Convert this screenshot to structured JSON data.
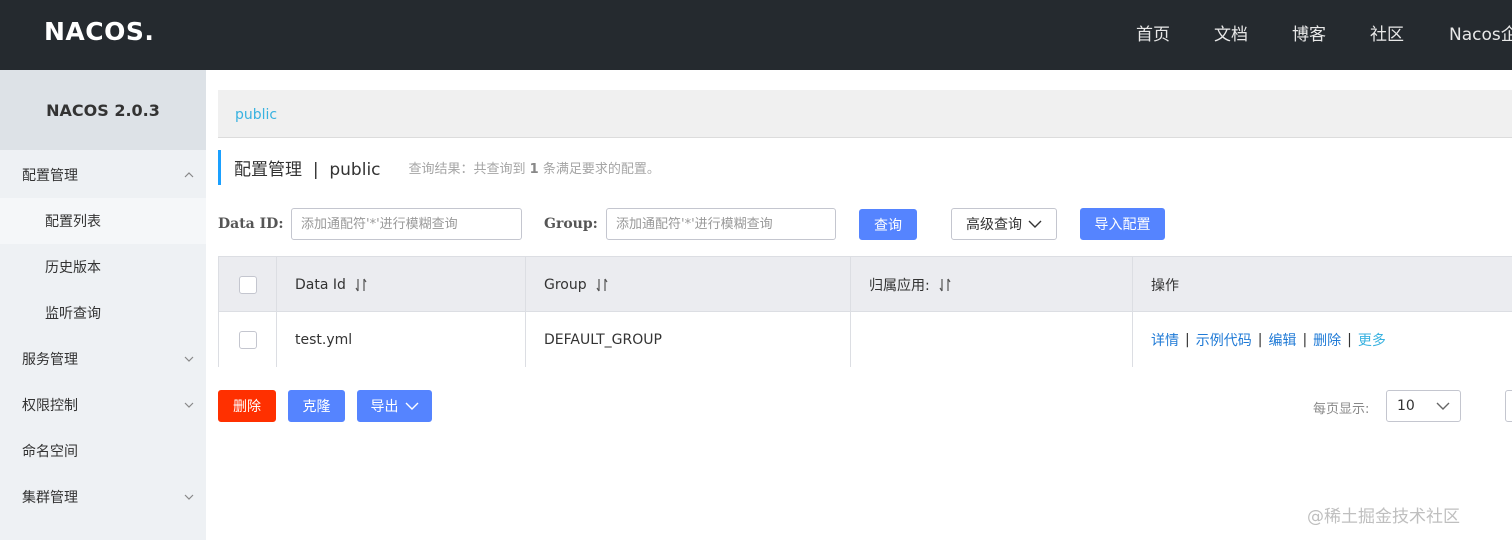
{
  "header": {
    "logo_text": "NACOS.",
    "nav": [
      "首页",
      "文档",
      "博客",
      "社区",
      "Nacos企"
    ]
  },
  "sidebar": {
    "version": "NACOS 2.0.3",
    "items": [
      {
        "label": "配置管理",
        "expanded": true
      },
      {
        "label": "配置列表",
        "active": true
      },
      {
        "label": "历史版本"
      },
      {
        "label": "监听查询"
      },
      {
        "label": "服务管理",
        "expanded": false
      },
      {
        "label": "权限控制",
        "expanded": false
      },
      {
        "label": "命名空间"
      },
      {
        "label": "集群管理",
        "expanded": false
      }
    ]
  },
  "breadcrumb": {
    "namespace": "public"
  },
  "title": {
    "main": "配置管理",
    "divider": "|",
    "namespace": "public",
    "result_prefix": "查询结果：共查询到",
    "result_count": "1",
    "result_suffix": "条满足要求的配置。"
  },
  "filters": {
    "dataid_label": "Data ID:",
    "dataid_placeholder": "添加通配符'*'进行模糊查询",
    "group_label": "Group:",
    "group_placeholder": "添加通配符'*'进行模糊查询",
    "search_button": "查询",
    "advanced_button": "高级查询",
    "import_button": "导入配置"
  },
  "table": {
    "columns": [
      "Data Id",
      "Group",
      "归属应用:",
      "操作"
    ],
    "rows": [
      {
        "data_id": "test.yml",
        "group": "DEFAULT_GROUP",
        "app": "",
        "ops": [
          "详情",
          "示例代码",
          "编辑",
          "删除",
          "更多"
        ]
      }
    ]
  },
  "bulk_actions": {
    "delete": "删除",
    "clone": "克隆",
    "export": "导出"
  },
  "pager": {
    "page_size_label": "每页显示:",
    "page_size": "10"
  },
  "watermark": "@稀土掘金技术社区",
  "colors": {
    "header_bg": "#252a2f",
    "primary": "#5584ff",
    "danger": "#ff3000",
    "link": "#1f7ad6",
    "accent": "#39b2e0"
  }
}
